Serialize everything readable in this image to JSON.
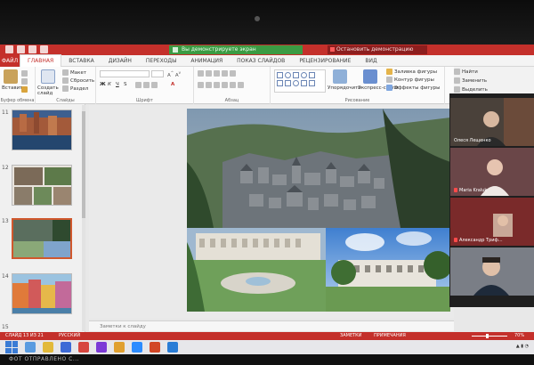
{
  "title_bar": {
    "meeting_banner": "Вы демонстрируете экран",
    "stop_button": "Остановить демонстрацию"
  },
  "tabs": {
    "file": "ФАЙЛ",
    "items": [
      {
        "label": "ГЛАВНАЯ",
        "active": true
      },
      {
        "label": "ВСТАВКА"
      },
      {
        "label": "ДИЗАЙН"
      },
      {
        "label": "ПЕРЕХОДЫ"
      },
      {
        "label": "АНИМАЦИЯ"
      },
      {
        "label": "ПОКАЗ СЛАЙДОВ"
      },
      {
        "label": "РЕЦЕНЗИРОВАНИЕ"
      },
      {
        "label": "ВИД"
      }
    ]
  },
  "ribbon": {
    "clipboard": {
      "paste": "Вставить",
      "label": "Буфер обмена"
    },
    "slides": {
      "new_slide": "Создать слайд",
      "layout": "Макет",
      "reset": "Сбросить",
      "section": "Раздел",
      "label": "Слайды"
    },
    "font": {
      "label": "Шрифт",
      "bold": "Ж",
      "italic": "К",
      "underline": "Ч",
      "strike": "S"
    },
    "paragraph": {
      "label": "Абзац"
    },
    "drawing": {
      "arrange": "Упорядочить",
      "quick_styles": "Экспресс-стили",
      "fill": "Заливка фигуры",
      "outline": "Контур фигуры",
      "effects": "Эффекты фигуры",
      "label": "Рисование"
    },
    "editing": {
      "find": "Найти",
      "replace": "Заменить",
      "select": "Выделить"
    }
  },
  "thumbnails": [
    {
      "number": "11"
    },
    {
      "number": "12"
    },
    {
      "number": "13",
      "selected": true
    },
    {
      "number": "14"
    },
    {
      "number": "15"
    }
  ],
  "notes": {
    "placeholder": "Заметки к слайду"
  },
  "participants": [
    {
      "name": "Олеся Лещенко",
      "muted": false
    },
    {
      "name": "Maria Kraluk",
      "muted": true
    },
    {
      "name": "Александр Триф...",
      "muted": true
    },
    {
      "name": "",
      "muted": false
    }
  ],
  "status_bar": {
    "slide_info": "СЛАЙД 13 ИЗ 21",
    "language": "РУССКИЙ",
    "notes": "ЗАМЕТКИ",
    "comments": "ПРИМЕЧАНИЯ",
    "zoom": "70%"
  },
  "bottom_label": "ФОТ ОТПРАВЛЕНО С..."
}
